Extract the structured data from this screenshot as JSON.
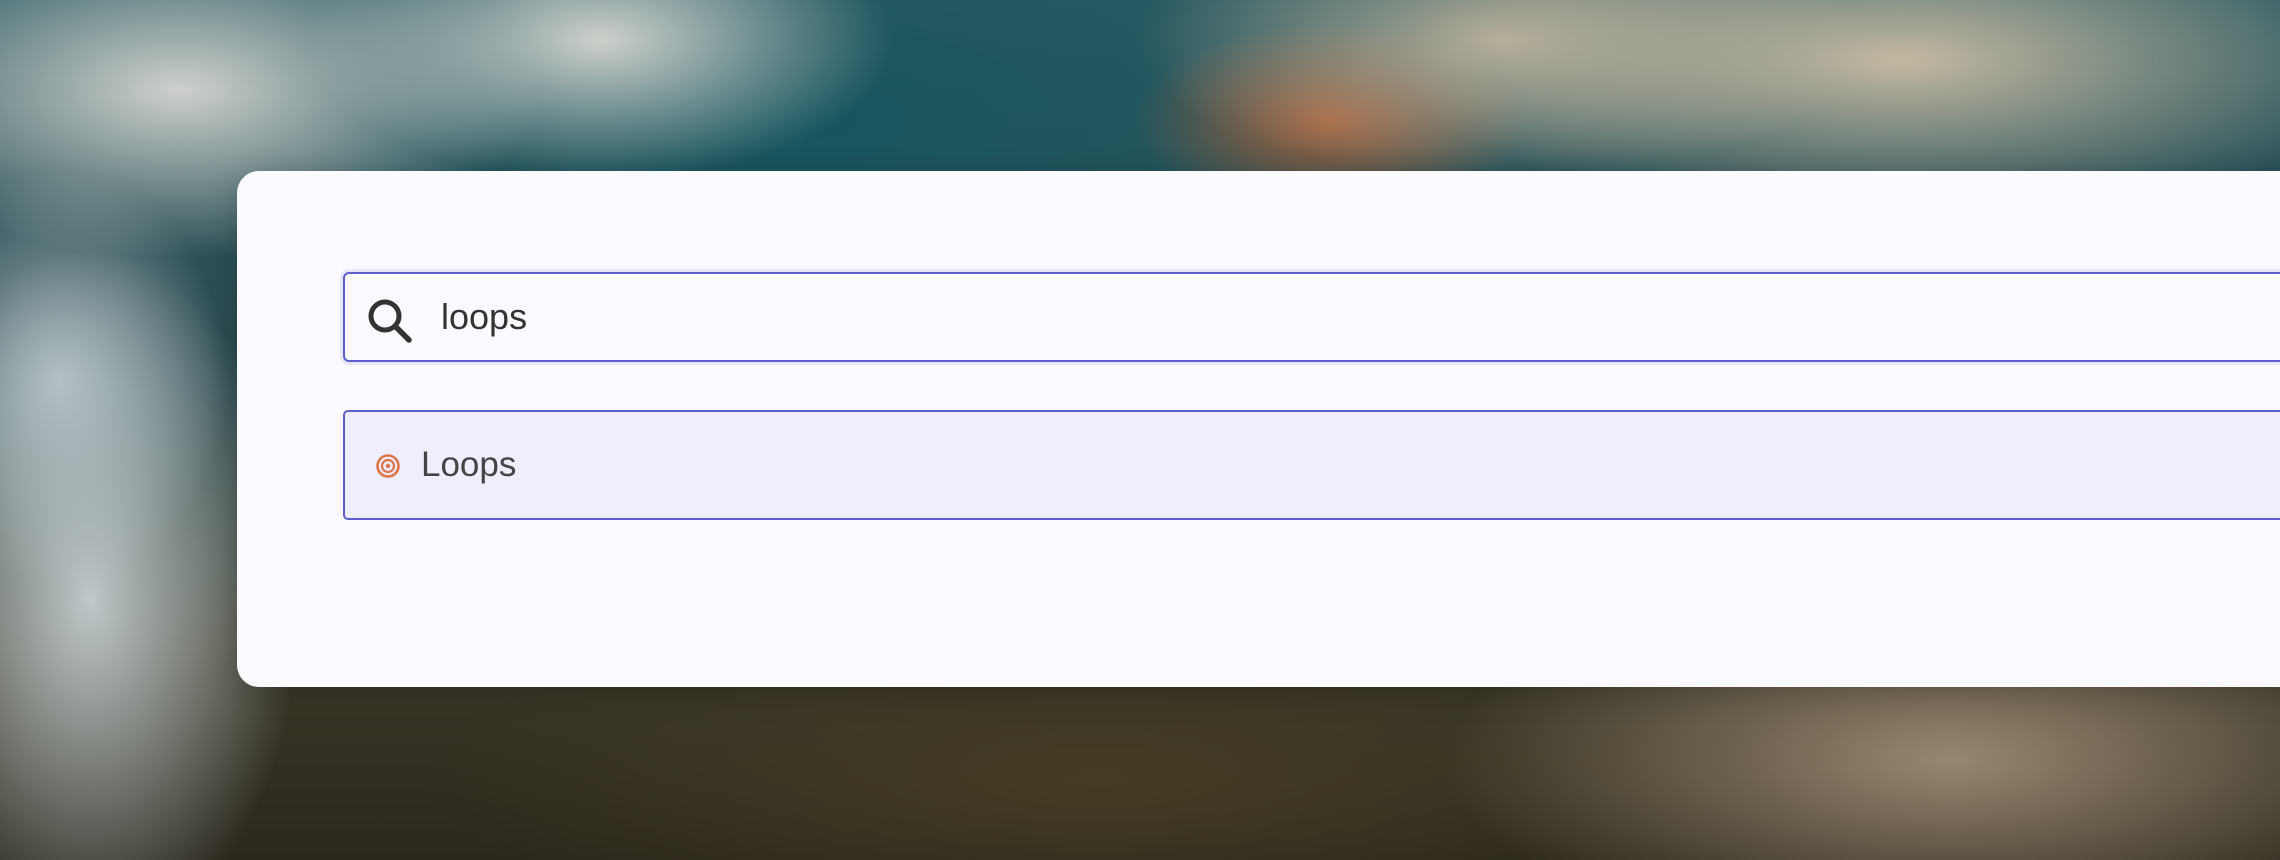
{
  "search": {
    "value": "loops",
    "icon": "search-icon"
  },
  "results": [
    {
      "label": "Loops",
      "icon": "loops-icon",
      "icon_color": "#e0754a"
    }
  ],
  "colors": {
    "accent": "#5e5fcd",
    "card_background": "#fbfaff",
    "selected_background": "#eeeefc"
  }
}
